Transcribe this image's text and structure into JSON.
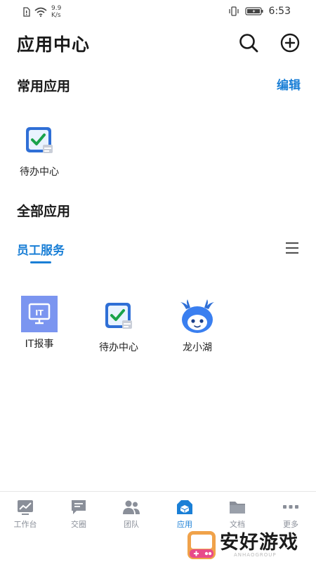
{
  "status_bar": {
    "speed_value": "9.9",
    "speed_unit": "K/s",
    "time": "6:53"
  },
  "header": {
    "title": "应用中心",
    "search_icon": "search-icon",
    "add_icon": "plus-circle-icon"
  },
  "common_apps": {
    "title": "常用应用",
    "edit_label": "编辑",
    "items": [
      {
        "label": "待办中心",
        "icon": "todo-check-icon"
      }
    ]
  },
  "all_apps": {
    "title": "全部应用",
    "active_tab": "员工服务",
    "menu_icon": "hamburger-menu-icon",
    "items": [
      {
        "label": "IT报事",
        "icon": "it-report-icon"
      },
      {
        "label": "待办中心",
        "icon": "todo-check-icon"
      },
      {
        "label": "龙小湖",
        "icon": "dragon-mascot-icon"
      }
    ]
  },
  "bottom_nav": {
    "items": [
      {
        "label": "工作台",
        "icon": "chart-screen-icon"
      },
      {
        "label": "交圈",
        "icon": "chat-bubble-icon"
      },
      {
        "label": "团队",
        "icon": "people-icon"
      },
      {
        "label": "应用",
        "icon": "app-box-icon",
        "active": true
      },
      {
        "label": "文档",
        "icon": "folder-icon"
      },
      {
        "label": "更多",
        "icon": "more-dots-icon"
      }
    ]
  },
  "watermark": {
    "text": "安好游戏",
    "sub": "ANHAOGROUP"
  },
  "colors": {
    "accent": "#1a7fd6",
    "nav_inactive": "#8a8f99",
    "it_icon_bg": "#7b95f0"
  }
}
